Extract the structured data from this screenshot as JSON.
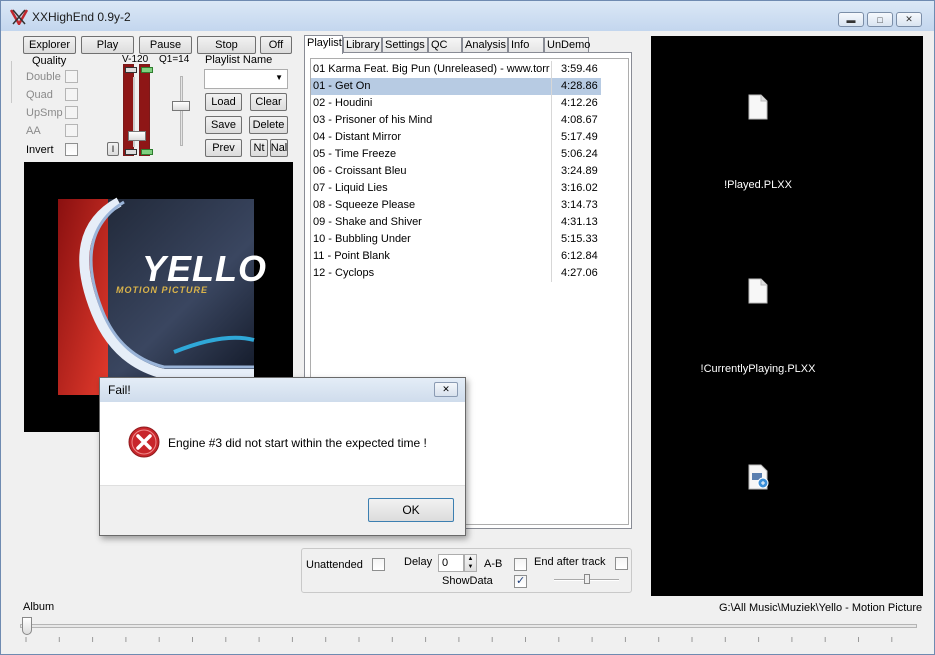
{
  "window": {
    "title": "XXHighEnd 0.9y-2"
  },
  "toolbar": {
    "explorer": "Explorer",
    "play": "Play",
    "pause": "Pause",
    "stop": "Stop",
    "off": "Off"
  },
  "quality": {
    "title": "Quality",
    "double": "Double",
    "quad": "Quad",
    "upsmp": "UpSmp",
    "aa": "AA",
    "invert": "Invert"
  },
  "levels": {
    "v_label": "V-120",
    "q_label": "Q1=14",
    "i_label": "I"
  },
  "playlist_name": {
    "label": "Playlist Name",
    "value": ""
  },
  "playlist_buttons": {
    "load": "Load",
    "clear": "Clear",
    "save": "Save",
    "delete": "Delete",
    "prev": "Prev",
    "nt": "Nt",
    "nal": "Nal"
  },
  "album_art": {
    "artist": "YELLO",
    "subtitle": "MOTION PICTURE"
  },
  "tabs": [
    "Playlist",
    "Library",
    "Settings",
    "QC",
    "Analysis",
    "Info",
    "UnDemo"
  ],
  "tracks": [
    {
      "title": "01 Karma Feat. Big Pun (Unreleased) - www.torr",
      "time": "3:59.46"
    },
    {
      "title": "01 - Get On",
      "time": "4:28.86"
    },
    {
      "title": "02 - Houdini",
      "time": "4:12.26"
    },
    {
      "title": "03 - Prisoner of his Mind",
      "time": "4:08.67"
    },
    {
      "title": "04 - Distant Mirror",
      "time": "5:17.49"
    },
    {
      "title": "05 - Time Freeze",
      "time": "5:06.24"
    },
    {
      "title": "06 - Croissant Bleu",
      "time": "3:24.89"
    },
    {
      "title": "07 - Liquid Lies",
      "time": "3:16.02"
    },
    {
      "title": "08 - Squeeze Please",
      "time": "3:14.73"
    },
    {
      "title": "09 - Shake and Shiver",
      "time": "4:31.13"
    },
    {
      "title": "10 - Bubbling Under",
      "time": "5:15.33"
    },
    {
      "title": "11 - Point Blank",
      "time": "6:12.84"
    },
    {
      "title": "12 - Cyclops",
      "time": "4:27.06"
    }
  ],
  "selected_track_index": 1,
  "files": [
    {
      "name": "!Played.PLXX",
      "icon": "document-icon"
    },
    {
      "name": "!CurrentlyPlaying.PLXX",
      "icon": "document-icon"
    },
    {
      "name": "",
      "icon": "media-file-icon"
    }
  ],
  "options": {
    "unattended": "Unattended",
    "delay": "Delay",
    "delay_value": "0",
    "ab": "A-B",
    "end_after_track": "End after track",
    "showdata": "ShowData",
    "showdata_checked": true
  },
  "status": {
    "album_label": "Album",
    "path": "G:\\All Music\\Muziek\\Yello - Motion Picture"
  },
  "dialog": {
    "title": "Fail!",
    "message": "Engine #3 did not start within the expected time !",
    "ok": "OK",
    "close": "✕"
  },
  "colors": {
    "selection": "#b7cbe3",
    "vu_red": "#8e1616",
    "error_red": "#c8262b"
  }
}
